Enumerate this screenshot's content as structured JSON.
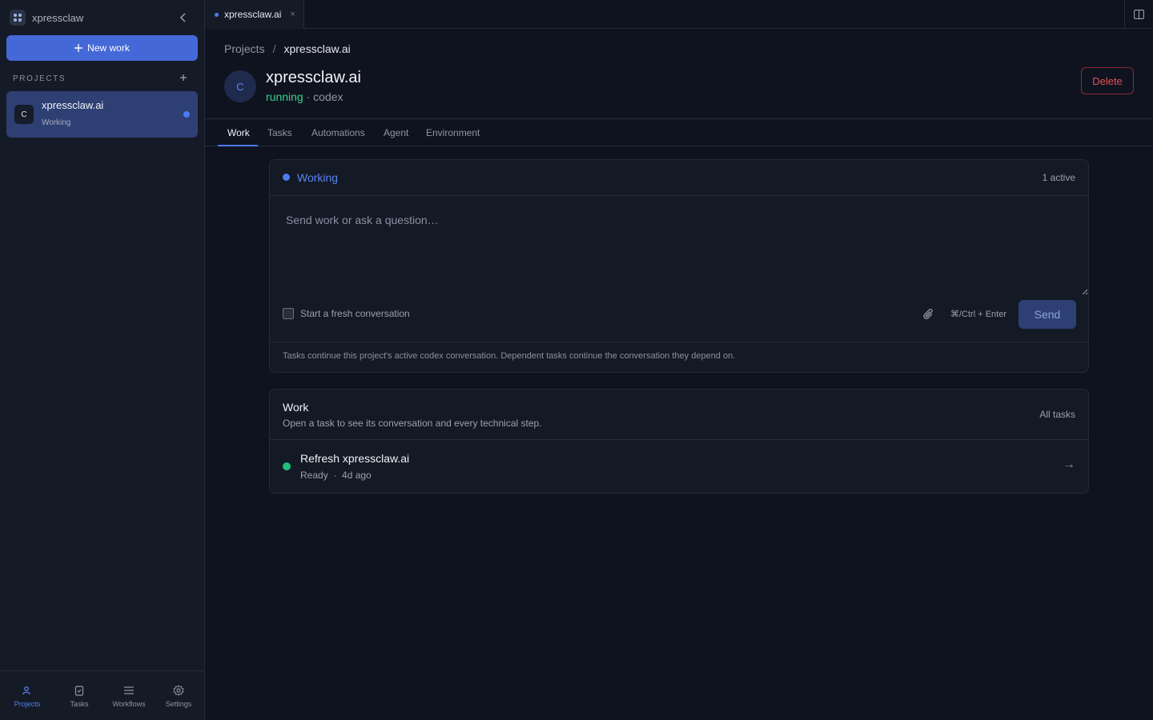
{
  "app": {
    "name": "xpressclaw"
  },
  "sidebar": {
    "new_work_label": "New work",
    "projects_label": "PROJECTS",
    "projects": [
      {
        "avatar": "C",
        "name": "xpressclaw.ai",
        "status": "Working"
      }
    ],
    "bottom_nav": [
      {
        "label": "Projects",
        "icon": "person-icon",
        "active": true
      },
      {
        "label": "Tasks",
        "icon": "clipboard-icon",
        "active": false
      },
      {
        "label": "Workflows",
        "icon": "list-icon",
        "active": false
      },
      {
        "label": "Settings",
        "icon": "gear-icon",
        "active": false
      }
    ]
  },
  "tabbar": {
    "tabs": [
      {
        "label": "xpressclaw.ai",
        "close": "×"
      }
    ]
  },
  "breadcrumb": {
    "root": "Projects",
    "separator": "/",
    "current": "xpressclaw.ai"
  },
  "project": {
    "avatar": "C",
    "title": "xpressclaw.ai",
    "state": "running",
    "separator": " · ",
    "runtime": "codex",
    "delete_label": "Delete"
  },
  "tabs": [
    "Work",
    "Tasks",
    "Automations",
    "Agent",
    "Environment"
  ],
  "composer": {
    "status_label": "Working",
    "active_count": "1 active",
    "placeholder": "Send work or ask a question…",
    "fresh_label": "Start a fresh conversation",
    "shortcut": "⌘/Ctrl + Enter",
    "send_label": "Send",
    "footer": "Tasks continue this project's active codex conversation. Dependent tasks continue the conversation they depend on."
  },
  "work": {
    "title": "Work",
    "subtitle": "Open a task to see its conversation and every technical step.",
    "all_tasks_label": "All tasks",
    "tasks": [
      {
        "title": "Refresh xpressclaw.ai",
        "status": "Ready",
        "separator": "·",
        "age": "4d ago"
      }
    ]
  },
  "colors": {
    "accent": "#4b7cf0",
    "running": "#3ccf8e",
    "danger": "#e05454",
    "ready": "#1fbf7a"
  }
}
